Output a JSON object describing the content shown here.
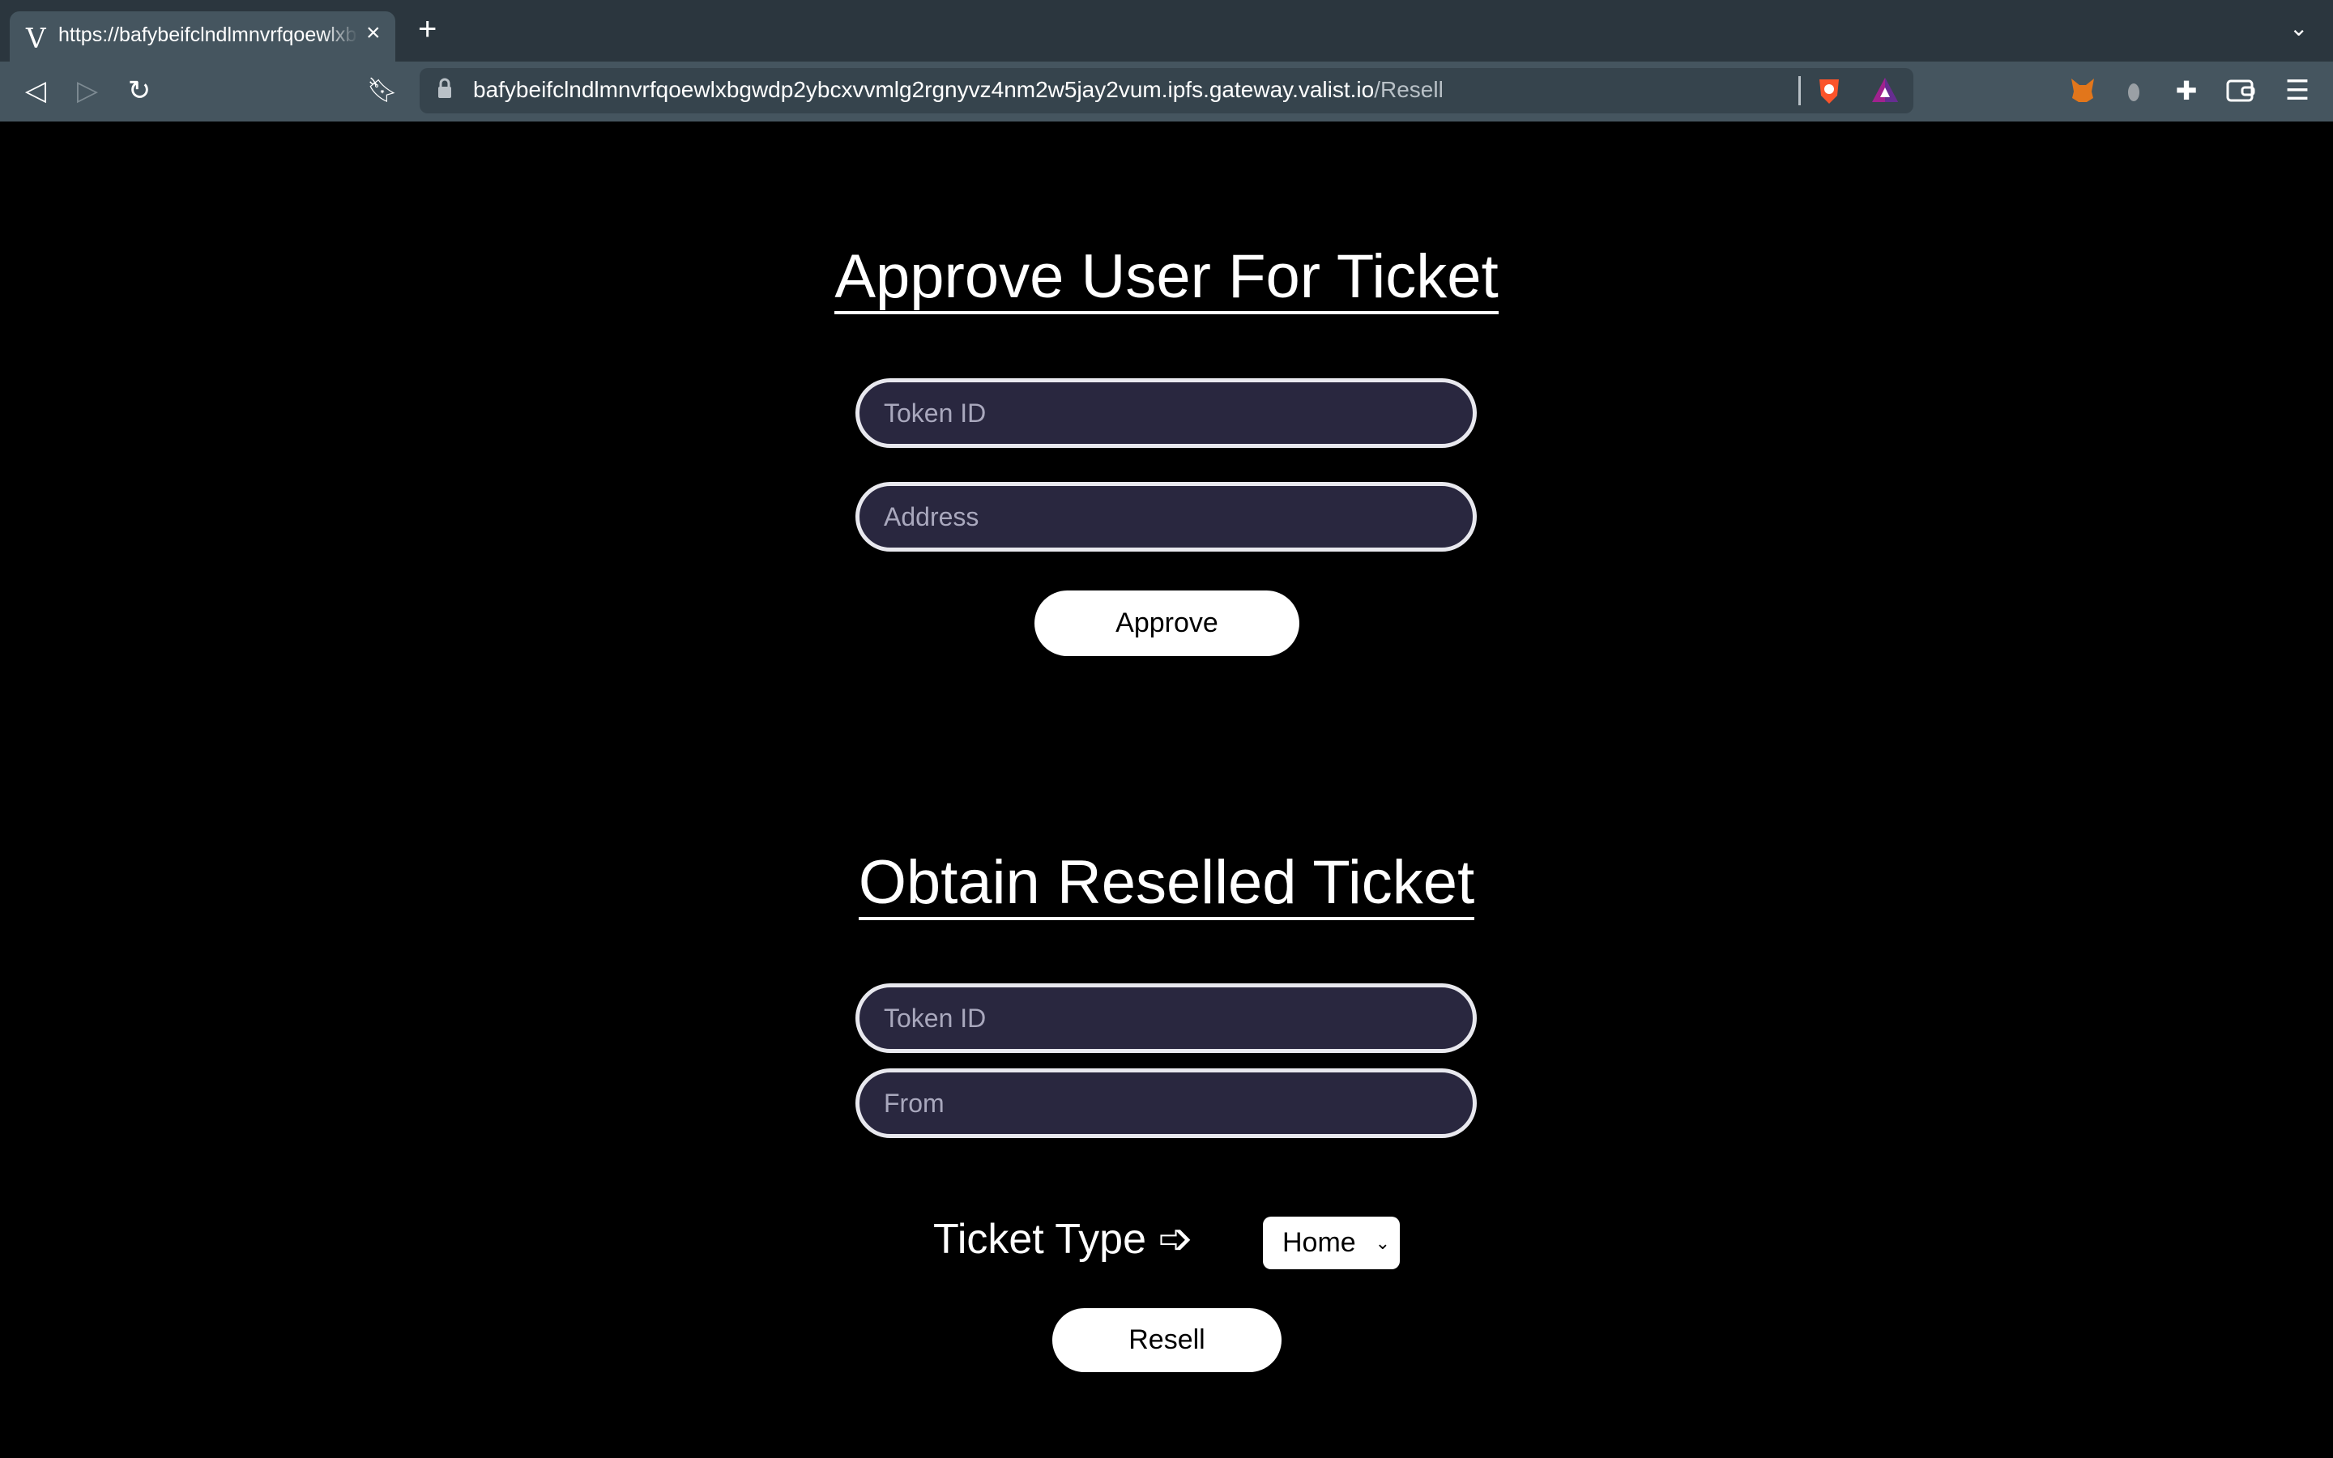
{
  "browser": {
    "tab_title": "https://bafybeifclndlmnvrfqoewlxbgwdp2ybcxvvmlg2rgnyvz4nm2w5jay2vum.ipfs.gateway.valist.io/Resell",
    "tab_logo": "V",
    "tab_close": "×",
    "new_tab": "+",
    "url_host": "bafybeifclndlmnvrfqoewlxbgwdp2ybcxvvmlg2rgnyvz4nm2w5jay2vum.ipfs.gateway.valist.io",
    "url_path": "/Resell",
    "icons": [
      "back-icon",
      "forward-icon",
      "reload-icon",
      "bookmark-icon",
      "lock-icon",
      "brave-shields-icon",
      "brave-rewards-icon",
      "metamask-icon",
      "extension-icon",
      "puzzle-icon",
      "wallet-icon",
      "menu-icon",
      "tab-list-chevron-icon"
    ]
  },
  "approve": {
    "heading": "Approve User For Ticket",
    "token_placeholder": "Token ID",
    "address_placeholder": "Address",
    "button": "Approve"
  },
  "resell": {
    "heading": "Obtain Reselled Ticket",
    "token_placeholder": "Token ID",
    "from_placeholder": "From",
    "ticket_type_label": "Ticket Type ➩",
    "ticket_type_selected": "Home",
    "button": "Resell"
  },
  "colors": {
    "input_bg": "#29273f",
    "page_bg": "#000000",
    "toolbar": "#45555f"
  }
}
